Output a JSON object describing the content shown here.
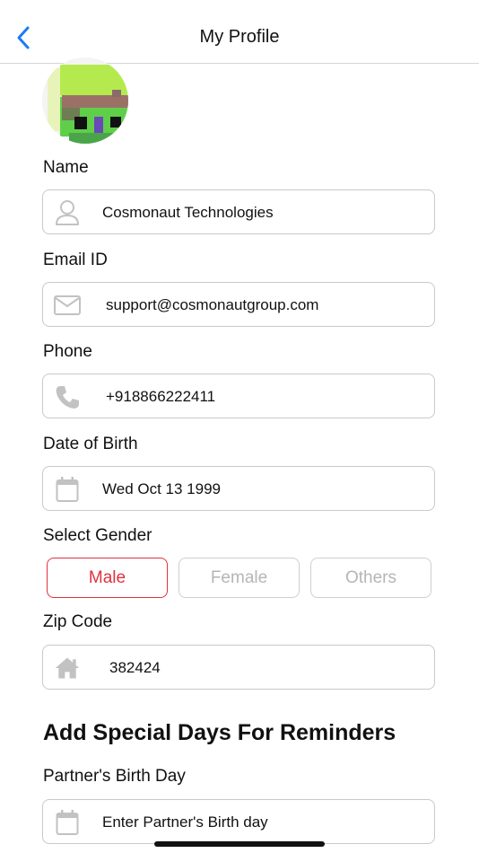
{
  "header": {
    "title": "My Profile"
  },
  "profile": {
    "name_label": "Name",
    "name_value": "Cosmonaut Technologies",
    "email_label": "Email ID",
    "email_value": "support@cosmonautgroup.com",
    "phone_label": "Phone",
    "phone_value": "+918866222411",
    "dob_label": "Date of Birth",
    "dob_value": "Wed Oct 13 1999",
    "gender_label": "Select Gender",
    "gender_options": [
      "Male",
      "Female",
      "Others"
    ],
    "gender_selected": "Male",
    "zip_label": "Zip Code",
    "zip_value": "382424"
  },
  "special_days": {
    "title": "Add Special Days For Reminders",
    "partner_label": "Partner's Birth Day",
    "partner_placeholder": "Enter Partner's Birth day"
  },
  "colors": {
    "accent_back": "#1a7cf5",
    "gender_active": "#e0323f",
    "icon_gray": "#c2c2c2"
  }
}
